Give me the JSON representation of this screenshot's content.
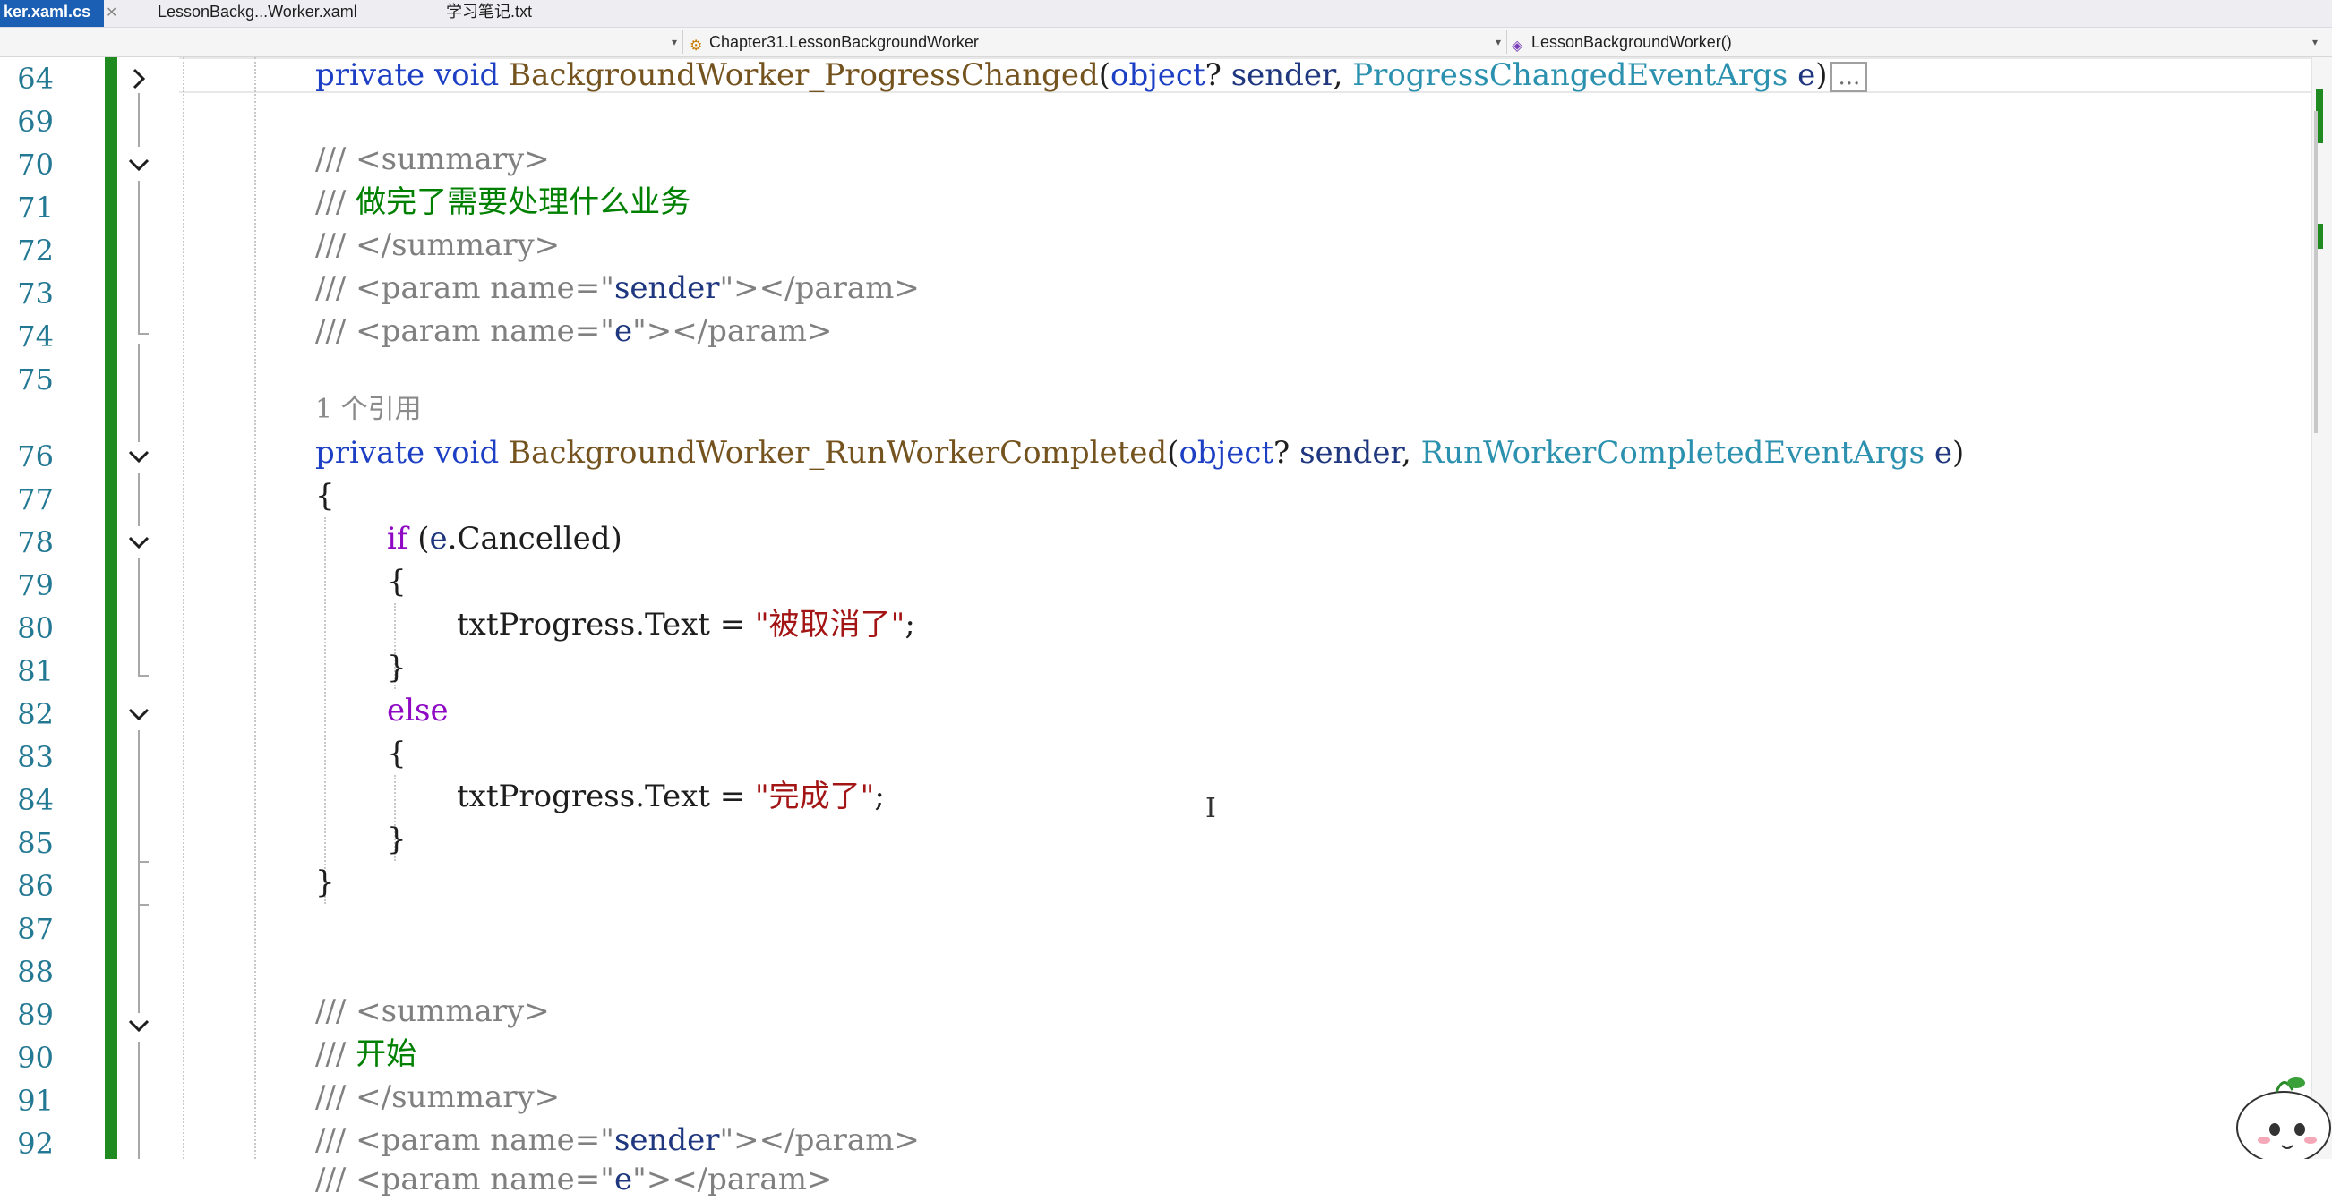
{
  "tabs": [
    {
      "label": "ker.xaml.cs",
      "active": true
    },
    {
      "label": "LessonBackg...Worker.xaml",
      "active": false
    },
    {
      "label": "学习笔记.txt",
      "active": false
    }
  ],
  "navbar": {
    "project": "",
    "class": "Chapter31.LessonBackgroundWorker",
    "member": "LessonBackgroundWorker()"
  },
  "editor": {
    "lines": [
      {
        "num": "64",
        "fold": "collapsed"
      },
      {
        "num": "69",
        "fold": "none"
      },
      {
        "num": "70",
        "fold": "expanded"
      },
      {
        "num": "71",
        "fold": "none"
      },
      {
        "num": "72",
        "fold": "none"
      },
      {
        "num": "73",
        "fold": "none"
      },
      {
        "num": "74",
        "fold": "end"
      },
      {
        "num": "75",
        "fold": "none"
      },
      {
        "num": "76",
        "fold": "expanded"
      },
      {
        "num": "77",
        "fold": "none"
      },
      {
        "num": "78",
        "fold": "expanded"
      },
      {
        "num": "79",
        "fold": "none"
      },
      {
        "num": "80",
        "fold": "none"
      },
      {
        "num": "81",
        "fold": "end"
      },
      {
        "num": "82",
        "fold": "expanded"
      },
      {
        "num": "83",
        "fold": "none"
      },
      {
        "num": "84",
        "fold": "none"
      },
      {
        "num": "85",
        "fold": "end"
      },
      {
        "num": "86",
        "fold": "end"
      },
      {
        "num": "87",
        "fold": "none"
      },
      {
        "num": "88",
        "fold": "expanded"
      },
      {
        "num": "89",
        "fold": "none"
      },
      {
        "num": "90",
        "fold": "none"
      },
      {
        "num": "91",
        "fold": "none"
      },
      {
        "num": "92",
        "fold": "none"
      }
    ],
    "code": {
      "l64": {
        "kw1": "private",
        "kw2": "void",
        "method": "BackgroundWorker_ProgressChanged",
        "p1": "(",
        "t1": "object",
        "p2": "? ",
        "v1": "sender",
        "p3": ", ",
        "t2": "ProgressChangedEventArgs",
        "p4": " ",
        "v2": "e",
        "p5": ")",
        "collapsed": "..."
      },
      "l70": {
        "slashes": "///",
        "tag": " <summary>"
      },
      "l71": {
        "slashes": "///",
        "text": " 做完了需要处理什么业务"
      },
      "l72": {
        "slashes": "///",
        "tag": " </summary>"
      },
      "l73": {
        "slashes": "///",
        "tag1": " <param name=\"",
        "name": "sender",
        "tag2": "\"></param>"
      },
      "l74": {
        "slashes": "///",
        "tag1": " <param name=\"",
        "name": "e",
        "tag2": "\"></param>"
      },
      "codelens": "1 个引用",
      "l76": {
        "kw1": "private",
        "kw2": "void",
        "method": "BackgroundWorker_RunWorkerCompleted",
        "p1": "(",
        "t1": "object",
        "p2": "? ",
        "v1": "sender",
        "p3": ", ",
        "t2": "RunWorkerCompletedEventArgs",
        "p4": " ",
        "v2": "e",
        "p5": ")"
      },
      "l77": "{",
      "l78": {
        "kw": "if",
        "rest1": " (",
        "v": "e",
        "rest2": ".Cancelled)"
      },
      "l79": "{",
      "l80": {
        "pre": "txtProgress.Text = ",
        "str": "\"被取消了\"",
        "post": ";"
      },
      "l81": "}",
      "l82": {
        "kw": "else"
      },
      "l83": "{",
      "l84": {
        "pre": "txtProgress.Text = ",
        "str": "\"完成了\"",
        "post": ";"
      },
      "l85": "}",
      "l86": "}",
      "l88": {
        "slashes": "///",
        "tag": " <summary>"
      },
      "l89": {
        "slashes": "///",
        "text": " 开始"
      },
      "l90": {
        "slashes": "///",
        "tag": " </summary>"
      },
      "l91": {
        "slashes": "///",
        "tag1": " <param name=\"",
        "name": "sender",
        "tag2": "\"></param>"
      },
      "l92": {
        "slashes": "///",
        "tag1": " <param name=\"",
        "name": "e",
        "tag2": "\"></param>"
      }
    }
  },
  "colors": {
    "change_bar": "#1f8a1f",
    "keyword": "#1d3fc4",
    "comment": "#008000",
    "string": "#a31515",
    "type": "#2b91af",
    "method": "#74531f"
  }
}
